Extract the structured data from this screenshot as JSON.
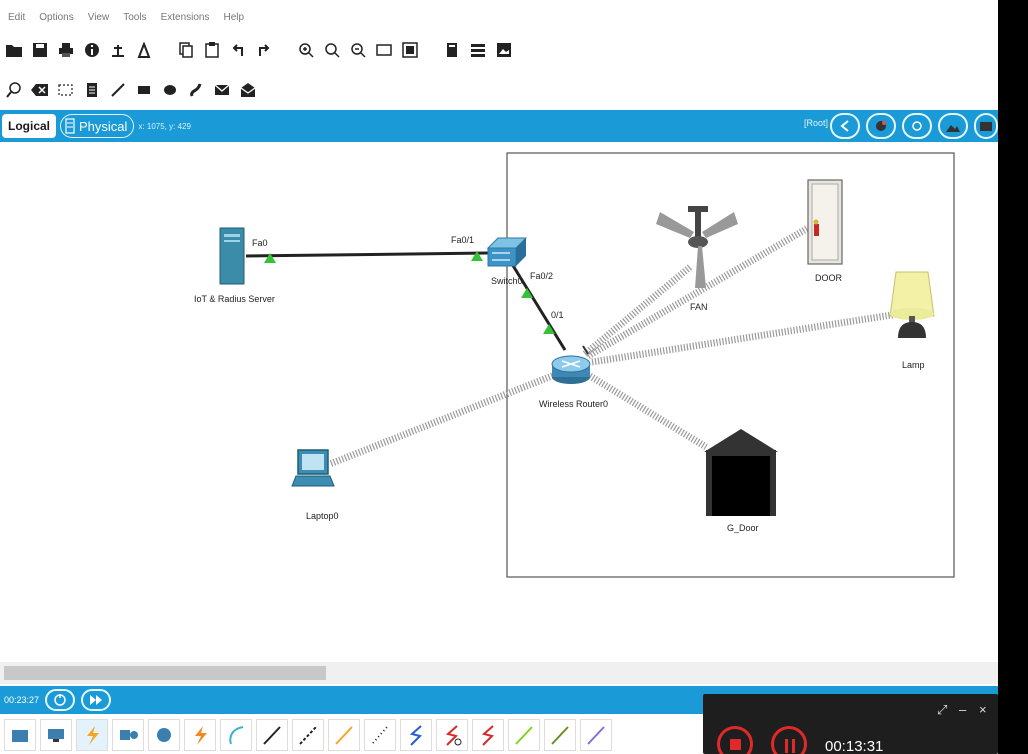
{
  "menu": [
    "Edit",
    "Options",
    "View",
    "Tools",
    "Extensions",
    "Help"
  ],
  "view_tabs": {
    "logical": "Logical",
    "physical": "Physical"
  },
  "coordinates": "x: 1075, y: 429",
  "root_label": "[Root]",
  "devices": {
    "server": "IoT & Radius Server",
    "switch": "Switch0",
    "router": "Wireless Router0",
    "laptop": "Laptop0",
    "fan": "FAN",
    "door": "DOOR",
    "lamp": "Lamp",
    "garage": "G_Door"
  },
  "ports": {
    "server_fa0": "Fa0",
    "switch_fa01": "Fa0/1",
    "switch_fa02": "Fa0/2",
    "router_01": "0/1"
  },
  "sim_time": "00:23:27",
  "recorder": {
    "time": "00:13:31"
  },
  "colors": {
    "accent": "#1a9ad6",
    "link": "#222222",
    "wireless": "#9a9a9a",
    "record": "#e02a2a"
  }
}
